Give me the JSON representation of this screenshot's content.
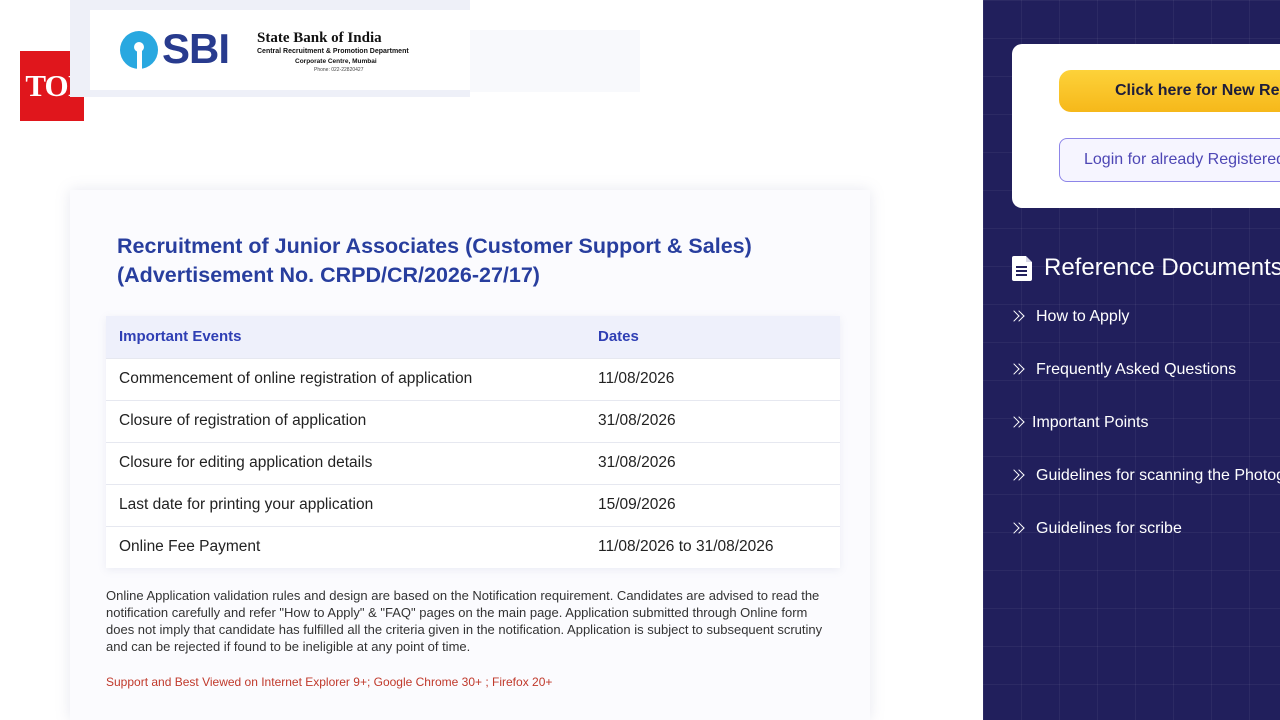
{
  "badge": {
    "label": "TOI"
  },
  "header": {
    "logo_text": "SBI",
    "bank_name": "State Bank of India",
    "department": "Central Recruitment & Promotion Department",
    "centre": "Corporate Centre, Mumbai",
    "phone": "Phone: 022-22820427"
  },
  "main": {
    "title_line1": "Recruitment of Junior Associates (Customer Support & Sales)",
    "title_line2": "(Advertisement No. CRPD/CR/2026-27/17)",
    "table": {
      "headers": [
        "Important Events",
        "Dates"
      ],
      "rows": [
        {
          "event": "Commencement of online registration of application",
          "date": "11/08/2026"
        },
        {
          "event": "Closure of registration of application",
          "date": "31/08/2026"
        },
        {
          "event": "Closure for editing application details",
          "date": "31/08/2026"
        },
        {
          "event": "Last date for printing your application",
          "date": "15/09/2026"
        },
        {
          "event": "Online Fee Payment",
          "date": "11/08/2026 to 31/08/2026"
        }
      ]
    },
    "notice": "Online Application validation rules and design are based on the Notification requirement. Candidates are advised to read the notification carefully and refer \"How to Apply\" & \"FAQ\" pages on the main page. Application submitted through Online form does not imply that candidate has fulfilled all the criteria given in the notification. Application is subject to subsequent scrutiny and can be rejected if found to be ineligible at any point of time.",
    "support": "Support and Best Viewed on Internet Explorer 9+; Google Chrome 30+ ; Firefox 20+"
  },
  "sidebar": {
    "new_registration_label": "Click here for New Registration",
    "login_label": "Login for already Registered",
    "reference_title": "Reference Documents",
    "items": [
      {
        "label": "How to Apply"
      },
      {
        "label": "Frequently Asked Questions"
      },
      {
        "label": "Important Points"
      },
      {
        "label": "Guidelines for scanning the Photograph"
      },
      {
        "label": "Guidelines for scribe"
      }
    ]
  },
  "colors": {
    "brand_blue": "#283e9e",
    "sidebar_bg": "#211f5c",
    "cta_yellow": "#f6b81a",
    "toi_red": "#e0161c"
  }
}
